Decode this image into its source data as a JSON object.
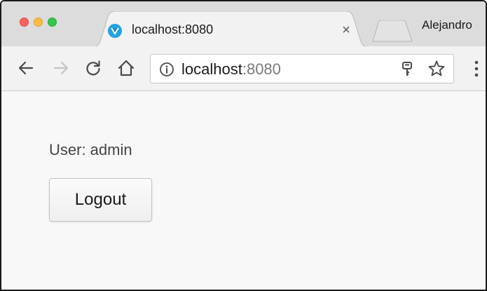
{
  "browser": {
    "tab": {
      "title": "localhost:8080",
      "close_glyph": "×",
      "favicon_letter": "V"
    },
    "profile_name": "Alejandro",
    "address_bar": {
      "host": "localhost",
      "port": ":8080"
    },
    "icons": {
      "back": "back-arrow-icon",
      "forward": "forward-arrow-icon",
      "reload": "reload-icon",
      "home": "home-icon",
      "info": "info-icon",
      "passwords": "key-icon",
      "bookmark": "star-icon",
      "menu": "vertical-dots-icon"
    },
    "colors": {
      "close": "#fc605b",
      "minimize": "#fdbc40",
      "maximize": "#34c84a",
      "favicon": "#21a3e6"
    }
  },
  "page": {
    "user_label": "User: admin",
    "logout_label": "Logout"
  }
}
